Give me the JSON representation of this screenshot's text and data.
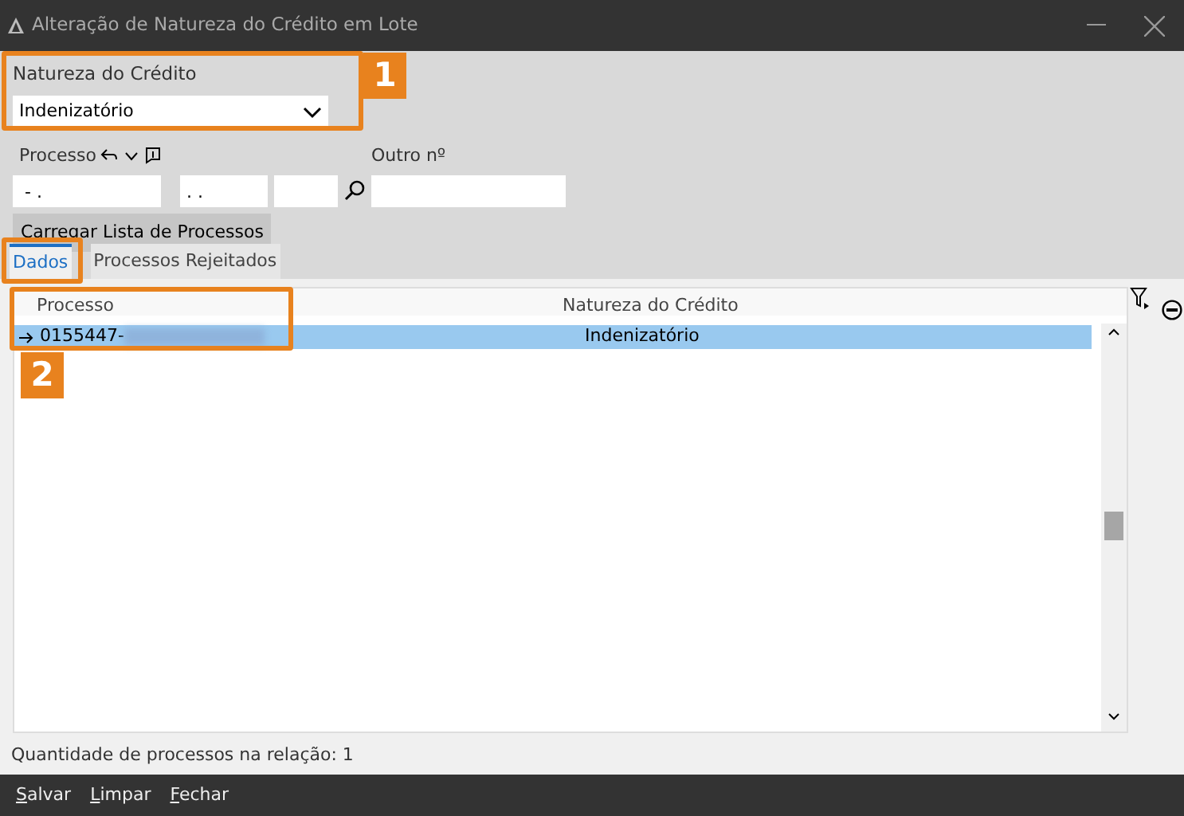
{
  "window": {
    "title": "Alteração de Natureza do Crédito em Lote"
  },
  "natureza": {
    "label": "Natureza do Crédito",
    "value": "Indenizatório"
  },
  "processo": {
    "label": "Processo",
    "fields": [
      {
        "value": " - ."
      },
      {
        "value": ". ."
      }
    ]
  },
  "outro": {
    "label": "Outro nº"
  },
  "load_button": "Carregar Lista de Processos",
  "tabs": [
    {
      "label": "Dados",
      "selected": true
    },
    {
      "label": "Processos Rejeitados",
      "selected": false
    }
  ],
  "table": {
    "columns": [
      "Processo",
      "Natureza do Crédito"
    ],
    "rows": [
      {
        "processo": "0155447-",
        "redacted": true,
        "natureza": "Indenizatório",
        "selected": true
      }
    ]
  },
  "count_text": "Quantidade de processos na relação: 1",
  "callouts": [
    {
      "label": "1"
    },
    {
      "label": "2"
    }
  ],
  "footer_buttons": [
    "Salvar",
    "Limpar",
    "Fechar"
  ]
}
